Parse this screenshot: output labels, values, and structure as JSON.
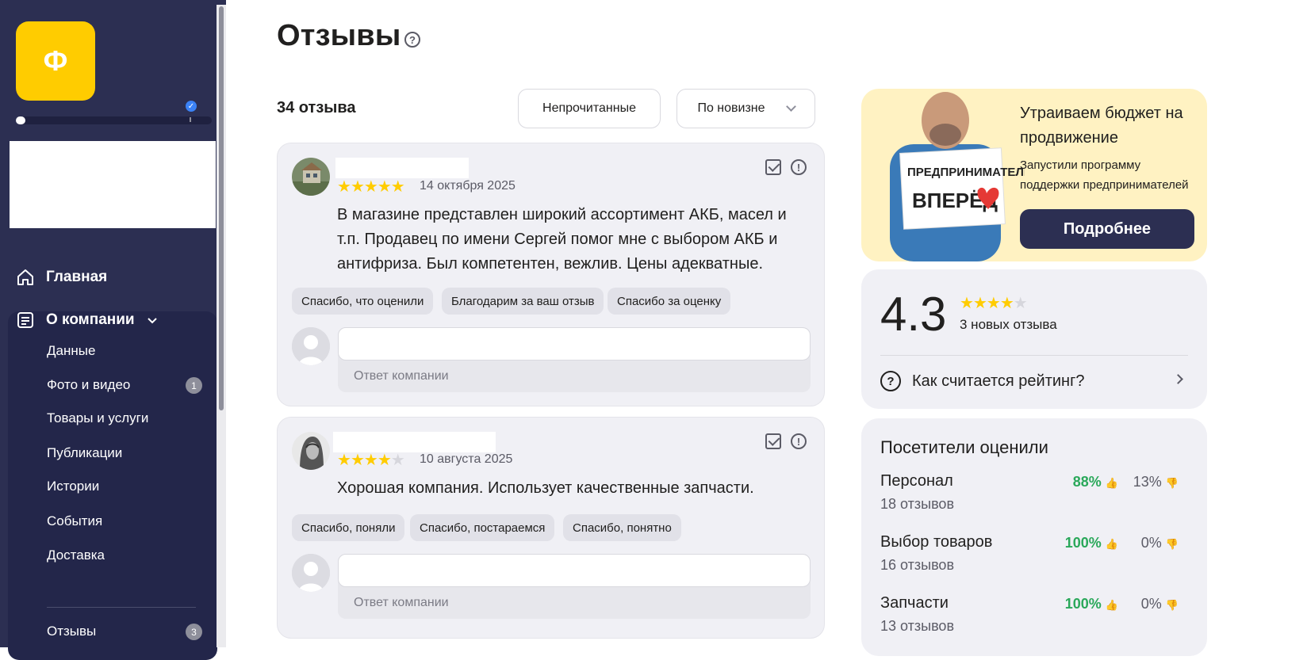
{
  "sidebar": {
    "logo_letter": "Ф",
    "profile_progress": 0.05,
    "nav": {
      "home": "Главная",
      "about": "О компании"
    },
    "sub_items": [
      {
        "label": "Данные"
      },
      {
        "label": "Фото и видео",
        "badge": "1"
      },
      {
        "label": "Товары и услуги"
      },
      {
        "label": "Публикации"
      },
      {
        "label": "Истории"
      },
      {
        "label": "События"
      },
      {
        "label": "Доставка"
      }
    ],
    "reviews_item": {
      "label": "Отзывы",
      "badge": "3"
    }
  },
  "main": {
    "title": "Отзывы",
    "help_glyph": "?",
    "count_label": "34 отзыва",
    "filter_unread": "Непрочитанные",
    "sort_label": "По новизне"
  },
  "reviews": [
    {
      "rating": 5,
      "date": "14 октября 2025",
      "text": "В магазине представлен широкий ассортимент АКБ, масел и т.п. Продавец по имени Сергей помог мне с выбором АКБ и антифриза. Был компетентен, вежлив. Цены адекватные.",
      "quick_replies": [
        "Спасибо, что оценили",
        "Благодарим за ваш отзыв",
        "Спасибо за оценку"
      ],
      "reply_label": "Ответ компании"
    },
    {
      "rating": 4,
      "date": "10 августа 2025",
      "text": "Хорошая компания. Использует качественные запчасти.",
      "quick_replies": [
        "Спасибо, поняли",
        "Спасибо, постараемся",
        "Спасибо, понятно"
      ],
      "reply_label": "Ответ компании"
    }
  ],
  "promo": {
    "title": "Утраиваем бюджет на продвижение",
    "subtitle": "Запустили программу поддержки предпринимателей",
    "button": "Подробнее",
    "sign_text_1": "ПРЕДПРИНИМАТЕЛИ,",
    "sign_text_2": "ВПЕРЁД"
  },
  "rating": {
    "value": "4.3",
    "stars_value": 4.3,
    "new_reviews": "3 новых отзыва",
    "how_calculated": "Как считается рейтинг?"
  },
  "visitors": {
    "title": "Посетители оценили",
    "aspects": [
      {
        "name": "Персонал",
        "count": "18 отзывов",
        "positive": "88%",
        "negative": "13%"
      },
      {
        "name": "Выбор товаров",
        "count": "16 отзывов",
        "positive": "100%",
        "negative": "0%"
      },
      {
        "name": "Запчасти",
        "count": "13 отзывов",
        "positive": "100%",
        "negative": "0%"
      }
    ]
  },
  "colors": {
    "sidebar_bg": "#2c2f52",
    "accent_yellow": "#ffcc00",
    "positive_green": "#2aa85a",
    "promo_bg": "#fff2c2"
  },
  "icons": {
    "home": "home-icon",
    "about": "document-icon",
    "approve": "check-square-icon",
    "report": "exclamation-circle-icon",
    "thumb_up": "thumb-up-icon",
    "thumb_down": "thumb-down-icon"
  }
}
